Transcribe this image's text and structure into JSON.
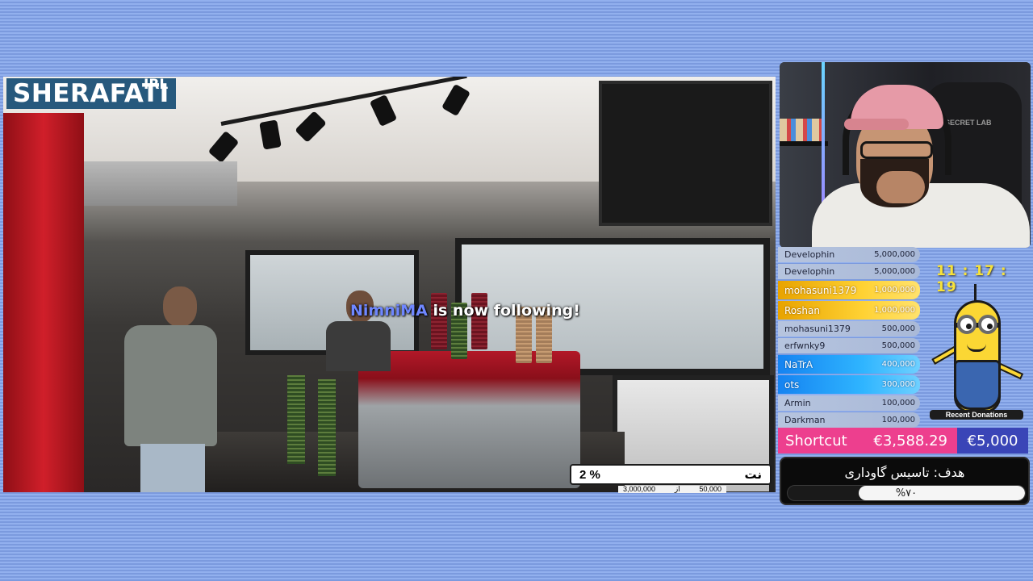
{
  "brand": {
    "name": "SHERAFATI",
    "suffix": "IRL"
  },
  "alert": {
    "follower": "NimniMA",
    "message": "is now following!"
  },
  "poll": {
    "left": "2 %",
    "right": "نت",
    "sub_left": "3,000,000",
    "sub_mid": "از",
    "sub_right": "50,000"
  },
  "donations": [
    {
      "name": "Develophin",
      "amount": "5,000,000",
      "tier": "plain"
    },
    {
      "name": "Develophin",
      "amount": "5,000,000",
      "tier": "plain"
    },
    {
      "name": "mohasuni1379",
      "amount": "1,000,000",
      "tier": "gold"
    },
    {
      "name": "Roshan",
      "amount": "1,000,000",
      "tier": "gold"
    },
    {
      "name": "mohasuni1379",
      "amount": "500,000",
      "tier": "plain"
    },
    {
      "name": "erfwnky9",
      "amount": "500,000",
      "tier": "plain"
    },
    {
      "name": "NaTrA",
      "amount": "400,000",
      "tier": "blue"
    },
    {
      "name": "ots",
      "amount": "300,000",
      "tier": "blue"
    },
    {
      "name": "Armin",
      "amount": "100,000",
      "tier": "plain"
    },
    {
      "name": "Darkman",
      "amount": "100,000",
      "tier": "plain"
    }
  ],
  "clock": "11 : 17 : 19",
  "recent_label": "Recent Donations",
  "shortcut": {
    "label": "Shortcut",
    "current": "€3,588.29",
    "target": "€5,000"
  },
  "goal": {
    "title": "هدف: تاسیس گاوداری",
    "percent_text": "%۷۰",
    "fraction": 0.7
  },
  "facecam": {
    "chair_brand": "SECRET LAB"
  },
  "colors": {
    "brand_bg": "#27597d",
    "shortcut_pink": "#ed3f8e",
    "shortcut_target": "#3a45b7",
    "follower_name": "#6f87ff",
    "clock": "#f7e23a"
  }
}
